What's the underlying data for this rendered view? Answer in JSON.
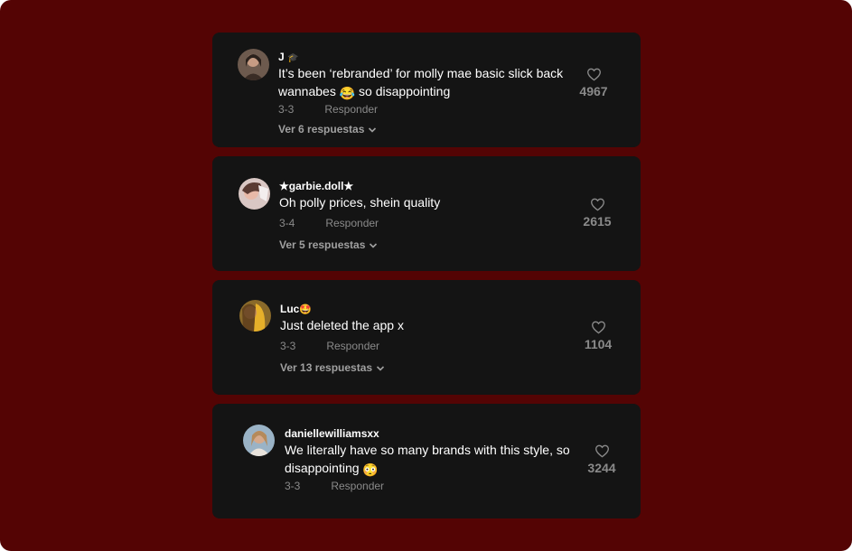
{
  "comments": [
    {
      "username": "J",
      "badge": "🎓",
      "text_lines": [
        "It’s been ‘rebranded’ for molly mae basic slick back",
        "wannabes"
      ],
      "text_tail": "so disappointing",
      "emoji": "😂",
      "date": "3-3",
      "reply_label": "Responder",
      "replies_label": "Ver 6 respuestas",
      "likes": "4967"
    },
    {
      "username": "★garbie.doll★",
      "text": "Oh polly prices, shein quality",
      "date": "3-4",
      "reply_label": "Responder",
      "replies_label": "Ver 5 respuestas",
      "likes": "2615"
    },
    {
      "username": "Luc",
      "emoji": "🤩",
      "text": "Just deleted the app x",
      "date": "3-3",
      "reply_label": "Responder",
      "replies_label": "Ver 13 respuestas",
      "likes": "1104"
    },
    {
      "username": "daniellewilliamsxx",
      "text_lines": [
        "We literally have so many brands with this style, so",
        "disappointing"
      ],
      "emoji": "😳",
      "date": "3-3",
      "reply_label": "Responder",
      "likes": "3244"
    }
  ],
  "colors": {
    "page_background": "#540404",
    "card_background": "#141414",
    "text_primary": "#ffffff",
    "text_muted": "#8a8a8a"
  },
  "icons": [
    "heart-outline-icon",
    "chevron-down-icon",
    "avatar"
  ]
}
